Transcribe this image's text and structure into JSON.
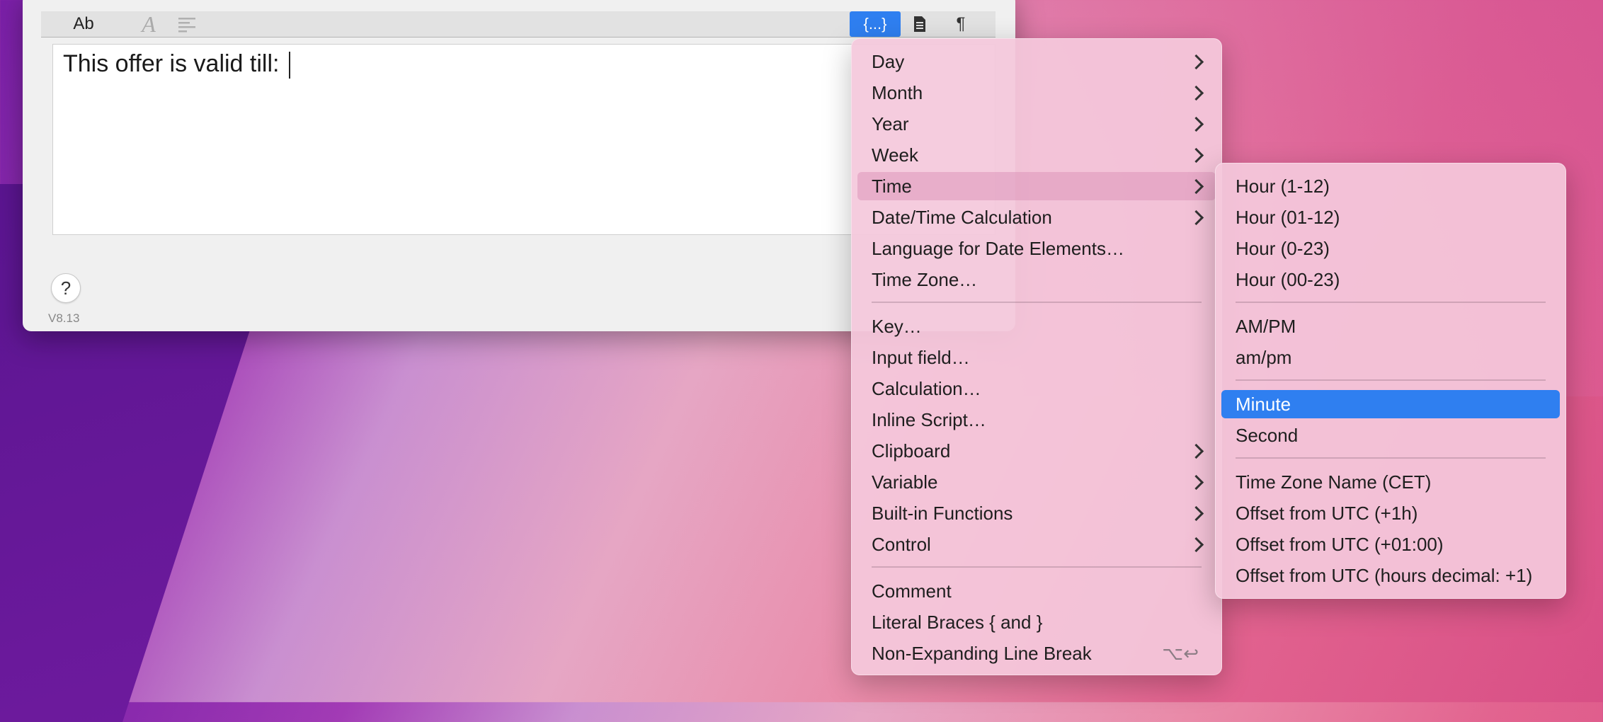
{
  "toolbar": {
    "ab": "Ab",
    "italic": "A",
    "align_icon": "align-left-icon",
    "braces": "{...}",
    "doc_icon": "document-icon",
    "para": "¶"
  },
  "editor": {
    "text": "This offer is valid till: "
  },
  "help": "?",
  "version": "V8.13",
  "menu": {
    "day": "Day",
    "month": "Month",
    "year": "Year",
    "week": "Week",
    "time": "Time",
    "datetime_calc": "Date/Time Calculation",
    "language": "Language for Date Elements…",
    "timezone": "Time Zone…",
    "key": "Key…",
    "input_field": "Input field…",
    "calculation": "Calculation…",
    "inline_script": "Inline Script…",
    "clipboard": "Clipboard",
    "variable": "Variable",
    "builtin": "Built-in Functions",
    "control": "Control",
    "comment": "Comment",
    "literal_braces": "Literal Braces { and }",
    "line_break": "Non-Expanding Line Break",
    "line_break_shortcut": "⌥↩"
  },
  "submenu": {
    "hour_1_12": "Hour (1-12)",
    "hour_01_12": "Hour (01-12)",
    "hour_0_23": "Hour (0-23)",
    "hour_00_23": "Hour (00-23)",
    "ampm_upper": "AM/PM",
    "ampm_lower": "am/pm",
    "minute": "Minute",
    "second": "Second",
    "tz_name": "Time Zone Name (CET)",
    "offset_1h": "Offset from UTC (+1h)",
    "offset_0100": "Offset from UTC (+01:00)",
    "offset_decimal": "Offset from UTC (hours decimal: +1)"
  },
  "colors": {
    "accent": "#2f7ff0"
  }
}
